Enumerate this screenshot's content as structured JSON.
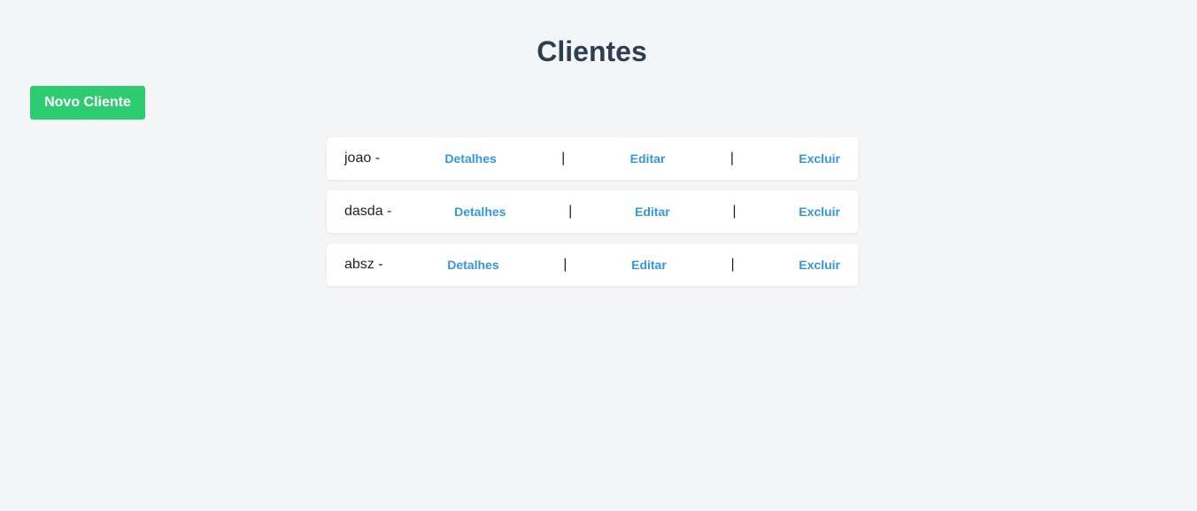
{
  "header": {
    "title": "Clientes"
  },
  "toolbar": {
    "new_label": "Novo Cliente"
  },
  "actions": {
    "details": "Detalhes",
    "edit": "Editar",
    "delete": "Excluir",
    "separator": "|"
  },
  "clients": [
    {
      "name": "joao -"
    },
    {
      "name": "dasda -"
    },
    {
      "name": "absz -"
    }
  ],
  "colors": {
    "background": "#f4f5f7",
    "title": "#2c3e50",
    "primary_button": "#2ecc71",
    "link": "#3498db",
    "row_background": "#ffffff"
  }
}
